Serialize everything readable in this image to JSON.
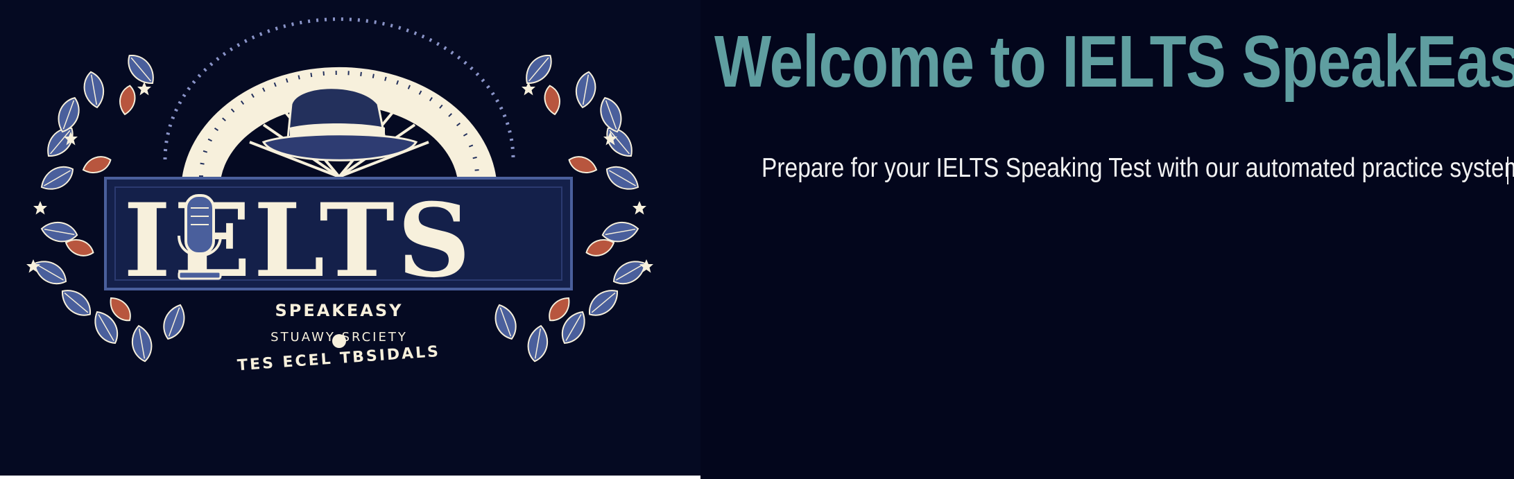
{
  "hero": {
    "title": "Welcome to IELTS SpeakEasy",
    "subtitle": "Prepare for your IELTS Speaking Test with our automated practice system."
  },
  "logo": {
    "main_text": "IELTS",
    "sub_text": "SPEAKEASY",
    "tagline_line1": "STUAWY SRCIETY",
    "tagline_line2": "TES ECEL TBSIDALS"
  },
  "colors": {
    "page_background": "#03061c",
    "title": "#5f9ea0",
    "subtitle": "#f2f2f2",
    "logo_cream": "#f7f0dc",
    "logo_navy": "#23305c",
    "logo_leaf_blue": "#4a5f9c",
    "logo_accent_red": "#b8563e"
  },
  "icons": [
    "microphone-icon",
    "hat-icon",
    "leaf-icon",
    "star-icon"
  ]
}
